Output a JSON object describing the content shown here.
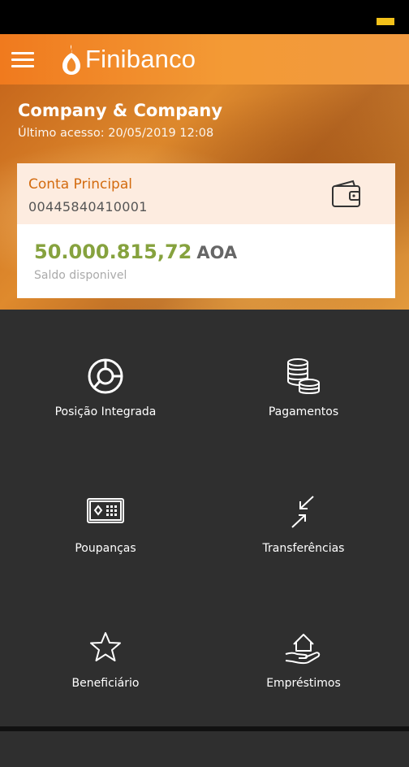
{
  "app": {
    "brand_name": "Finibanco",
    "colors": {
      "primary": "#f07a1e",
      "balance": "#86a23e",
      "account_title": "#d36b0f",
      "background": "#2f2f2f"
    }
  },
  "user": {
    "company_name": "Company & Company",
    "last_access": "Último acesso: 20/05/2019 12:08"
  },
  "account": {
    "name": "Conta Principal",
    "number": "00445840410001",
    "balance": "50.000.815,72",
    "currency": "AOA",
    "balance_label": "Saldo disponivel",
    "icon": "wallet-icon"
  },
  "menu": [
    {
      "label": "Posição Integrada",
      "icon": "pie-chart-icon"
    },
    {
      "label": "Pagamentos",
      "icon": "coins-stack-icon"
    },
    {
      "label": "Poupanças",
      "icon": "safe-icon"
    },
    {
      "label": "Transferências",
      "icon": "transfer-arrows-icon"
    },
    {
      "label": "Beneficiário",
      "icon": "star-icon"
    },
    {
      "label": "Empréstimos",
      "icon": "hand-house-icon"
    }
  ]
}
